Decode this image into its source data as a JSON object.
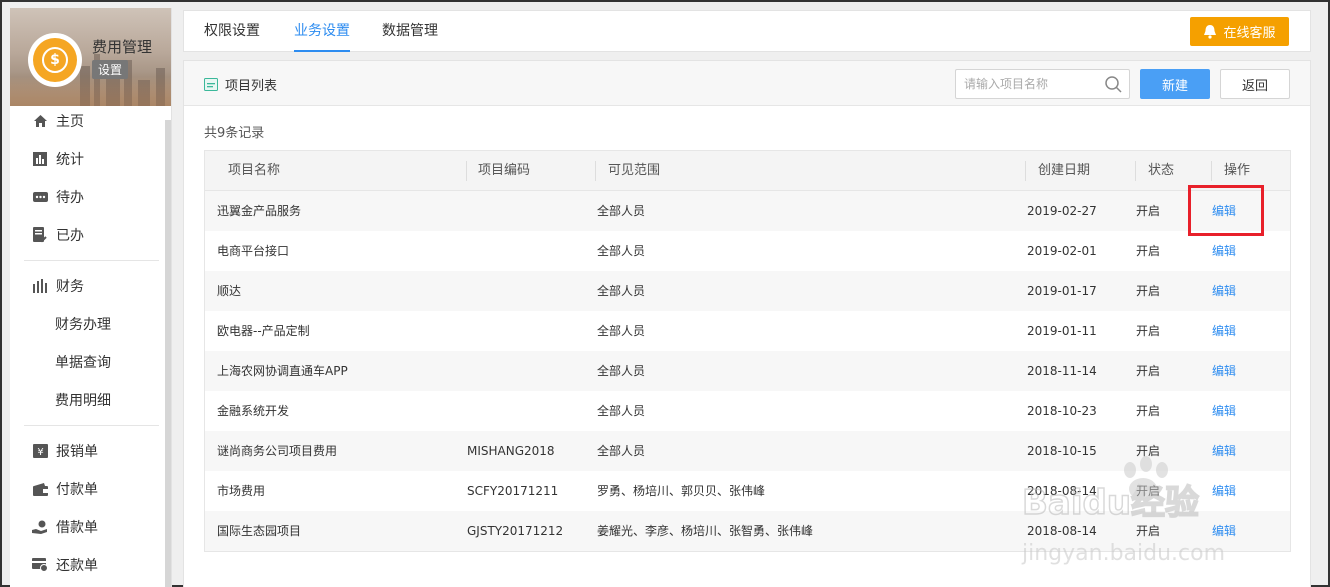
{
  "sidebar": {
    "brand_title": "费用管理",
    "brand_badge": "设置",
    "items": [
      {
        "label": "主页",
        "icon": "home-icon"
      },
      {
        "label": "统计",
        "icon": "bar-chart-icon"
      },
      {
        "label": "待办",
        "icon": "todo-icon"
      },
      {
        "label": "已办",
        "icon": "done-icon"
      }
    ],
    "finance": {
      "label": "财务",
      "icon": "finance-icon",
      "children": [
        "财务办理",
        "单据查询",
        "费用明细"
      ]
    },
    "documents": [
      {
        "label": "报销单",
        "icon": "reimbursement-icon"
      },
      {
        "label": "付款单",
        "icon": "wallet-icon"
      },
      {
        "label": "借款单",
        "icon": "loan-icon"
      },
      {
        "label": "还款单",
        "icon": "repayment-icon"
      }
    ]
  },
  "topbar": {
    "tabs": [
      "权限设置",
      "业务设置",
      "数据管理"
    ],
    "active_tab": "业务设置",
    "service_label": "在线客服"
  },
  "panel": {
    "title": "项目列表",
    "search_placeholder": "请输入项目名称",
    "new_label": "新建",
    "back_label": "返回",
    "record_count": "共9条记录"
  },
  "table": {
    "headers": [
      "项目名称",
      "项目编码",
      "可见范围",
      "创建日期",
      "状态",
      "操作"
    ],
    "rows": [
      {
        "name": "迅翼金产品服务",
        "code": "",
        "scope": "全部人员",
        "date": "2019-02-27",
        "status": "开启",
        "action": "编辑"
      },
      {
        "name": "电商平台接口",
        "code": "",
        "scope": "全部人员",
        "date": "2019-02-01",
        "status": "开启",
        "action": "编辑"
      },
      {
        "name": "顺达",
        "code": "",
        "scope": "全部人员",
        "date": "2019-01-17",
        "status": "开启",
        "action": "编辑"
      },
      {
        "name": "欧电器--产品定制",
        "code": "",
        "scope": "全部人员",
        "date": "2019-01-11",
        "status": "开启",
        "action": "编辑"
      },
      {
        "name": "上海农网协调直通车APP",
        "code": "",
        "scope": "全部人员",
        "date": "2018-11-14",
        "status": "开启",
        "action": "编辑"
      },
      {
        "name": "金融系统开发",
        "code": "",
        "scope": "全部人员",
        "date": "2018-10-23",
        "status": "开启",
        "action": "编辑"
      },
      {
        "name": "谜尚商务公司项目费用",
        "code": "MISHANG2018",
        "scope": "全部人员",
        "date": "2018-10-15",
        "status": "开启",
        "action": "编辑"
      },
      {
        "name": "市场费用",
        "code": "SCFY20171211",
        "scope": "罗勇、杨培川、郭贝贝、张伟峰",
        "date": "2018-08-14",
        "status": "开启",
        "action": "编辑"
      },
      {
        "name": "国际生态园项目",
        "code": "GJSTY20171212",
        "scope": "姜耀光、李彦、杨培川、张智勇、张伟峰",
        "date": "2018-08-14",
        "status": "开启",
        "action": "编辑"
      }
    ]
  },
  "watermark": {
    "text": "Baidu经验",
    "subtext": "jingyan.baidu.com"
  },
  "colors": {
    "accent": "#2d8cf0",
    "service": "#f5a000",
    "primary_button": "#4a9ff5",
    "highlight": "#e8202a"
  }
}
